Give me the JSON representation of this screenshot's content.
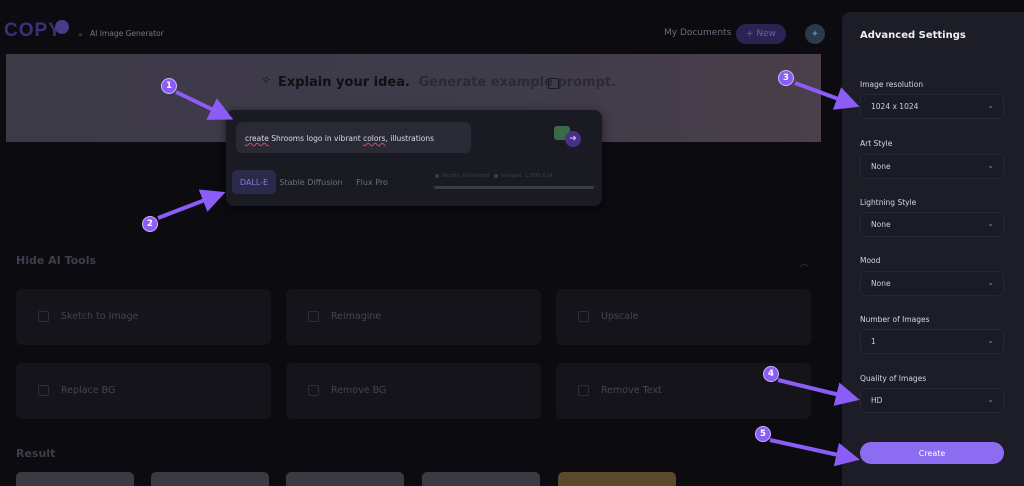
{
  "header": {
    "logo_text": "COPY",
    "breadcrumb_sep": "»",
    "breadcrumb": "AI Image Generator",
    "my_documents": "My Documents",
    "new_label": "+ New"
  },
  "banner": {
    "title_main": "Explain your idea.",
    "title_secondary": "Generate example prompt."
  },
  "prompt": {
    "w1": "create",
    "w2": " Shrooms logo in vibrant ",
    "w3": "colors",
    "w4": ", illustrations"
  },
  "model_tabs": [
    {
      "label": "DALL-E",
      "active": true
    },
    {
      "label": "Stable Diffusion",
      "active": false
    },
    {
      "label": "Flux Pro",
      "active": false
    }
  ],
  "tab_meta": {
    "a": "Words",
    "b": "Unlimited",
    "c": "Images",
    "d": "1,000,624",
    "progress": 1
  },
  "tools": {
    "title": "Hide AI Tools",
    "items": [
      {
        "label": "Sketch to Image"
      },
      {
        "label": "Reimagine"
      },
      {
        "label": "Upscale"
      },
      {
        "label": "Replace BG"
      },
      {
        "label": "Remove BG"
      },
      {
        "label": "Remove Text"
      }
    ]
  },
  "result": {
    "title": "Result"
  },
  "settings": {
    "title": "Advanced Settings",
    "fields": [
      {
        "label": "Image resolution",
        "value": "1024 x 1024"
      },
      {
        "label": "Art Style",
        "value": "None"
      },
      {
        "label": "Lightning Style",
        "value": "None"
      },
      {
        "label": "Mood",
        "value": "None"
      },
      {
        "label": "Number of Images",
        "value": "1"
      },
      {
        "label": "Quality of Images",
        "value": "HD"
      }
    ],
    "create_label": "Create"
  },
  "markers": [
    "1",
    "2",
    "3",
    "4",
    "5"
  ],
  "colors": {
    "accent": "#8b5cf6",
    "create_button": "#8c6cf0",
    "panel": "#1c1d27",
    "background": "#0b0b10"
  }
}
